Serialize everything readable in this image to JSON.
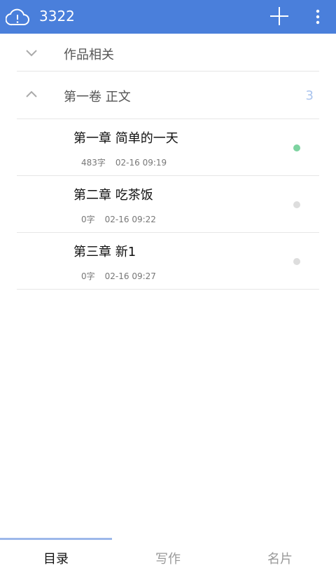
{
  "app": {
    "title": "3322"
  },
  "icons": {
    "sync": "cloud-alert-icon",
    "add": "plus-icon",
    "menu": "more-vert-icon"
  },
  "colors": {
    "appbar": "#4a7fdb",
    "status_synced": "#7dd3a0",
    "status_unsynced": "#dddddd",
    "tab_indicator": "#9db8ea"
  },
  "volumes": [
    {
      "title": "作品相关",
      "expanded": false,
      "count": ""
    },
    {
      "title": "第一卷 正文",
      "expanded": true,
      "count": "3"
    }
  ],
  "chapters": [
    {
      "title": "第一章 简单的一天",
      "words": "483字",
      "time": "02-16 09:19",
      "status": "synced"
    },
    {
      "title": "第二章 吃茶饭",
      "words": "0字",
      "time": "02-16 09:22",
      "status": "unsynced"
    },
    {
      "title": "第三章 新1",
      "words": "0字",
      "time": "02-16 09:27",
      "status": "unsynced"
    }
  ],
  "tabs": [
    {
      "label": "目录",
      "active": true
    },
    {
      "label": "写作",
      "active": false
    },
    {
      "label": "名片",
      "active": false
    }
  ]
}
